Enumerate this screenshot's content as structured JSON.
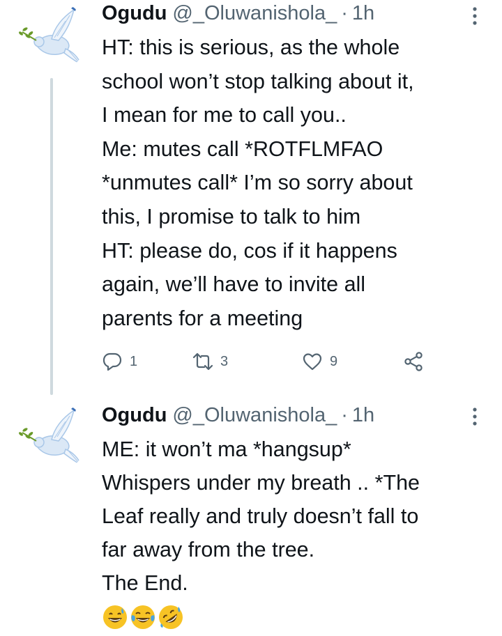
{
  "tweets": [
    {
      "author": {
        "name": "Ogudu",
        "handle": "@_Oluwanishola_",
        "separator": "·",
        "time": "1h",
        "avatar_icon": "dove-with-olive-branch-icon"
      },
      "text": "HT: this is serious, as the whole\nschool won’t stop talking about it,\nI mean for me to call you..\nMe: mutes call *ROTFLMFAO\n*unmutes call* I’m so sorry about\nthis, I promise to talk to him\nHT: please do, cos if it happens\nagain, we’ll have to invite all\nparents for a meeting",
      "metrics": {
        "replies": "1",
        "retweets": "3",
        "likes": "9"
      }
    },
    {
      "author": {
        "name": "Ogudu",
        "handle": "@_Oluwanishola_",
        "separator": "·",
        "time": "1h",
        "avatar_icon": "dove-with-olive-branch-icon"
      },
      "text": "ME: it won’t ma *hangsup*\nWhispers under my breath .. *The\nLeaf really and truly doesn’t fall to\nfar away from the tree.\nThe End.",
      "emojis": [
        "grinning-face-with-sweat-emoji",
        "face-with-tears-of-joy-emoji",
        "rolling-on-the-floor-laughing-emoji"
      ]
    }
  ],
  "colors": {
    "text": "#0f1419",
    "secondary": "#536471",
    "thread_line": "#cfd9de",
    "avatar_dove": "#a9c7e8",
    "avatar_beak": "#3b6fb6",
    "olive": "#6a9a2a",
    "emoji_yellow": "#f7c325",
    "emoji_blue": "#4aa3df"
  }
}
